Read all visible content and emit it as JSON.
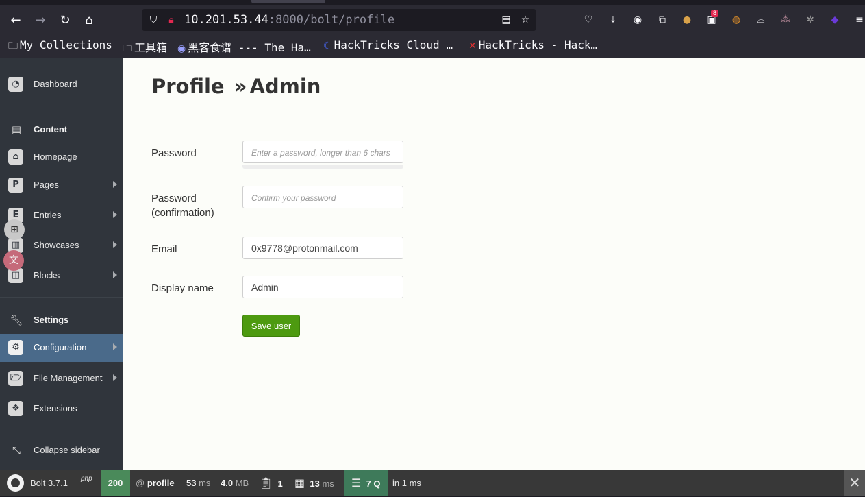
{
  "browser": {
    "url_host": "10.201.53.44",
    "url_rest": ":8000/bolt/profile",
    "notification_count": "8",
    "bookmarks": [
      {
        "icon": "folder-icon",
        "label": "My Collections"
      },
      {
        "icon": "folder-icon",
        "label": "工具箱"
      },
      {
        "icon": "site-icon",
        "label": "黑客食谱 --- The Ha…"
      },
      {
        "icon": "hacktricks-cloud-icon",
        "label": "HackTricks Cloud …"
      },
      {
        "icon": "hacktricks-icon",
        "label": "HackTricks - Hack…"
      }
    ]
  },
  "sidebar": {
    "items": [
      {
        "label": "Dashboard",
        "icon": "dashboard-icon"
      },
      {
        "label": "Content",
        "icon": "document-icon"
      },
      {
        "label": "Homepage",
        "icon": "home-icon"
      },
      {
        "label": "Pages",
        "icon": "pages-icon",
        "icon_char": "P"
      },
      {
        "label": "Entries",
        "icon": "entries-icon",
        "icon_char": "E"
      },
      {
        "label": "Showcases",
        "icon": "gift-icon"
      },
      {
        "label": "Blocks",
        "icon": "blocks-icon"
      },
      {
        "label": "Settings",
        "icon": "wrench-icon"
      },
      {
        "label": "Configuration",
        "icon": "cogs-icon"
      },
      {
        "label": "File Management",
        "icon": "folder-open-icon"
      },
      {
        "label": "Extensions",
        "icon": "cubes-icon"
      },
      {
        "label": "Collapse sidebar",
        "icon": "collapse-icon"
      }
    ]
  },
  "main": {
    "title_strong": "Profile",
    "title_sep": "»",
    "title_rest": "Admin",
    "form": {
      "password_label": "Password",
      "password_placeholder": "Enter a password, longer than 6 chars",
      "password_confirm_label_1": "Password",
      "password_confirm_label_2": "(confirmation)",
      "password_confirm_placeholder": "Confirm your password",
      "email_label": "Email",
      "email_value": "0x9778@protonmail.com",
      "display_name_label": "Display name",
      "display_name_value": "Admin",
      "save_label": "Save user"
    }
  },
  "debugbar": {
    "version": "Bolt 3.7.1",
    "php": "php",
    "status": "200",
    "at": "@",
    "route": "profile",
    "time_value": "53",
    "time_unit": "ms",
    "memory_value": "4.0",
    "memory_unit": "MB",
    "templates_count": "1",
    "render_value": "13",
    "render_unit": "ms",
    "queries": "7 Q",
    "queries_time": "in 1 ms"
  }
}
